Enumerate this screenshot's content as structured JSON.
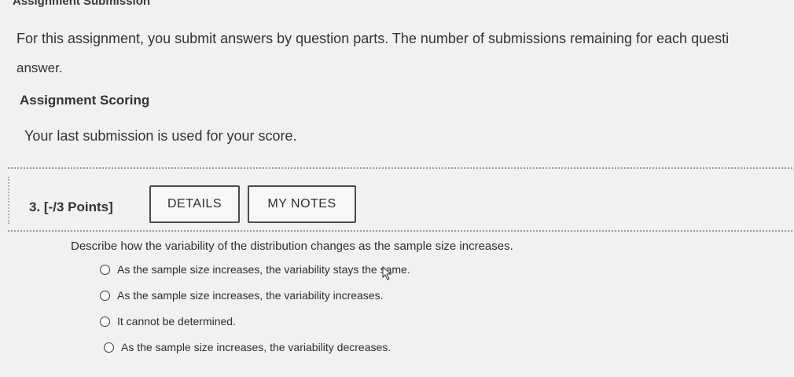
{
  "submission": {
    "heading": "Assignment Submission",
    "intro_line1": "For this assignment, you submit answers by question parts. The number of submissions remaining for each questi",
    "intro_line2": "answer."
  },
  "scoring": {
    "heading": "Assignment Scoring",
    "text": "Your last submission is used for your score."
  },
  "question": {
    "label": "3.  [-/3 Points]",
    "details_button": "DETAILS",
    "notes_button": "MY NOTES",
    "prompt": "Describe how the variability of the distribution changes as the sample size increases.",
    "options": [
      "As the sample size increases, the variability stays the same.",
      "As the sample size increases, the variability increases.",
      "It cannot be determined.",
      "As the sample size increases, the variability decreases."
    ]
  }
}
